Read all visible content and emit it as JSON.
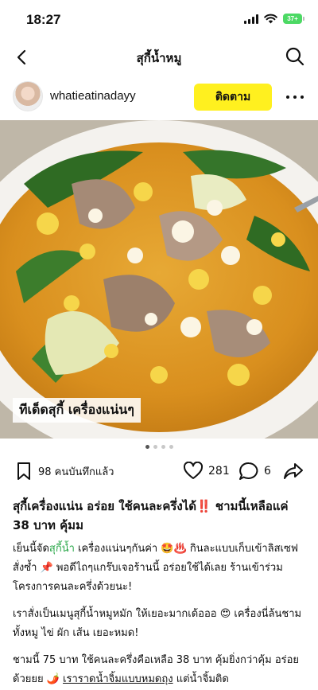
{
  "status_bar": {
    "time": "18:27",
    "battery": "37+"
  },
  "header": {
    "title": "สุกี้น้ำหมู"
  },
  "author": {
    "username": "whatieatinadayy",
    "follow_label": "ติดตาม"
  },
  "photo": {
    "overlay_text": "ทีเด็ดสุกี้ เครื่องแน่นๆ",
    "page_count": 4,
    "current_page": 1
  },
  "actions": {
    "saves_text": "98 คนบันทึกแล้ว",
    "likes": "281",
    "comments": "6"
  },
  "post": {
    "title": "สุกี้เครื่องแน่น อร่อย ใช้คนละครึ่งได้‼️ ชามนี้เหลือแค่ 38 บาท คุ้มม",
    "p1_a": "เย็นนี้จัด",
    "p1_tag": "สุกี้น้ำ",
    "p1_b": " เครื่องแน่นๆกันค่า 🤩♨️ กินละแบบเก็บเข้าลิสเซฟสั่งซ้ำ 📌 พอดีไถๆแกร๊บเจอร้านนี้ อร่อยใช้ได้เลย ร้านเข้าร่วมโครงการคนละครึ่งด้วยนะ!",
    "p2": "เราสั่งเป็นเมนูสุกี้น้ำหมูหมัก ให้เยอะมากเด้อออ 😍 เครื่องนี่ล้นชาม ทั้งหมู ไข่ ผัก เส้น เยอะหมด!",
    "p3_a": "ชามนี้ 75 บาท ใช้คนละครึ่งคือเหลือ 38 บาท คุ้มยิ่งกว่าคุ้ม อร่อยด้วยยย 🌶️ ",
    "p3_b": "เราราดน้ำจิ้มแบบหมดถุง",
    "p3_c": " แต่น้ำจิ้มติด"
  }
}
